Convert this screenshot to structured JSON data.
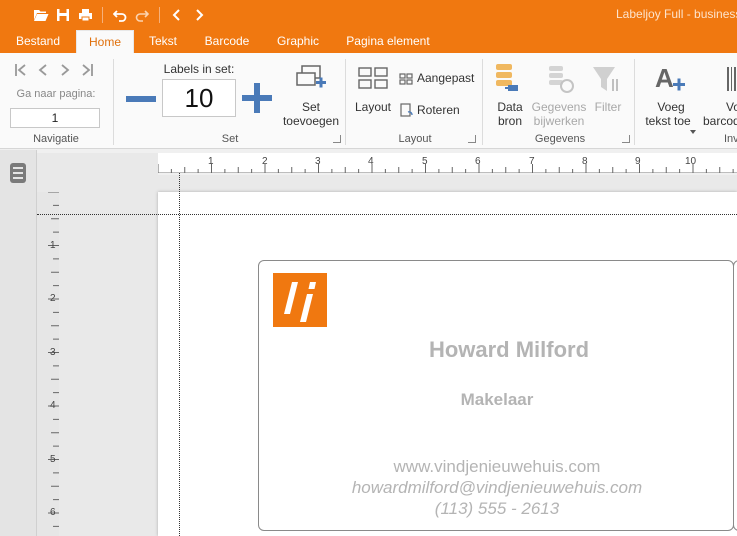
{
  "titlebar": {
    "title": "Labeljoy Full - business"
  },
  "tabs": [
    {
      "label": "Bestand"
    },
    {
      "label": "Home"
    },
    {
      "label": "Tekst"
    },
    {
      "label": "Barcode"
    },
    {
      "label": "Graphic"
    },
    {
      "label": "Pagina element"
    }
  ],
  "navigatie": {
    "goto_label": "Ga naar pagina:",
    "page_value": "1",
    "group_label": "Navigatie"
  },
  "set": {
    "labels_in_set_label": "Labels in set:",
    "value": "10",
    "add_set_label_1": "Set",
    "add_set_label_2": "toevoegen",
    "group_label": "Set"
  },
  "layout": {
    "layout_label": "Layout",
    "custom_label": "Aangepast",
    "rotate_label": "Roteren",
    "group_label": "Layout"
  },
  "gegevens": {
    "datasource_label_1": "Data",
    "datasource_label_2": "bron",
    "update_label_1": "Gegevens",
    "update_label_2": "bijwerken",
    "filter_label": "Filter",
    "group_label": "Gegevens"
  },
  "invoegen": {
    "addtext_label_1": "Voeg",
    "addtext_label_2": "tekst toe",
    "addbarcode_label_1": "Vo",
    "addbarcode_label_2": "barcod",
    "group_label": "Inv"
  },
  "ruler": {
    "h_numbers": [
      "1",
      "2",
      "3",
      "4",
      "5",
      "6",
      "7",
      "8",
      "9",
      "10"
    ],
    "v_numbers": [
      "1",
      "2",
      "3",
      "4",
      "5",
      "6"
    ]
  },
  "card": {
    "name": "Howard Milford",
    "role": "Makelaar",
    "website": "www.vindjenieuwehuis.com",
    "email": "howardmilford@vindjenieuwehuis.com",
    "phone": "(113) 555 - 2613"
  },
  "colors": {
    "accent": "#f07810",
    "logo": "#f07810",
    "card_text": "#b4b4b4",
    "icon_blue": "#4a7ab8"
  }
}
